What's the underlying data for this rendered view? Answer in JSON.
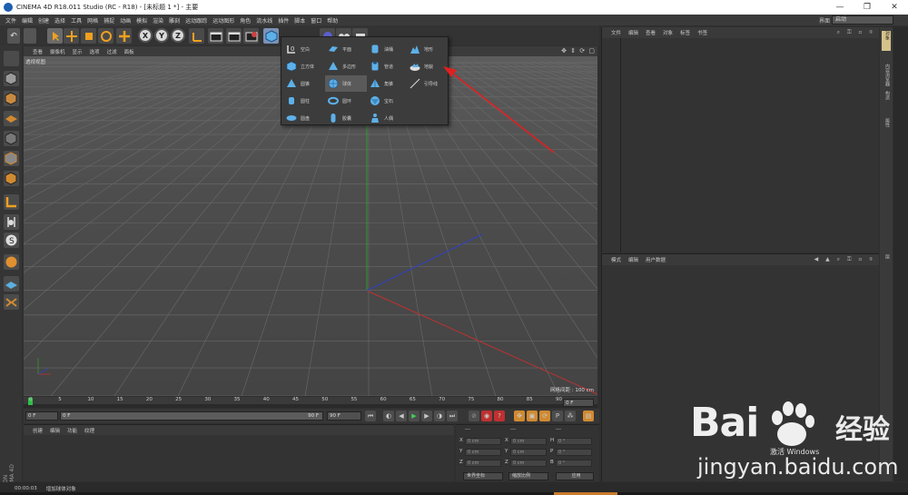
{
  "window": {
    "title": "CINEMA 4D R18.011 Studio (RC - R18) - [未标题 1 *] - 主要",
    "controls": [
      "—",
      "❐",
      "✕"
    ]
  },
  "menubar": {
    "items": [
      "文件",
      "编辑",
      "创建",
      "选择",
      "工具",
      "网格",
      "捕捉",
      "动画",
      "模拟",
      "渲染",
      "雕刻",
      "运动跟踪",
      "运动图形",
      "角色",
      "流水线",
      "插件",
      "脚本",
      "窗口",
      "帮助"
    ],
    "layout_label": "界面",
    "layout_value": "启动"
  },
  "viewport": {
    "menu": [
      "查看",
      "摄像机",
      "显示",
      "选项",
      "过滤",
      "面板"
    ],
    "label": "透视视图",
    "grid_info": "网格间距 : 100 cm",
    "nav_icons": "✥ ⇕ ⟳ ▢"
  },
  "palette": {
    "items": [
      {
        "label": "空白",
        "icon": "null-icon"
      },
      {
        "label": "立方体",
        "icon": "cube-icon"
      },
      {
        "label": "圆锥",
        "icon": "cone-icon"
      },
      {
        "label": "圆柱",
        "icon": "cylinder-icon"
      },
      {
        "label": "圆盘",
        "icon": "disc-icon"
      },
      {
        "label": "平面",
        "icon": "plane-icon"
      },
      {
        "label": "多边形",
        "icon": "polygon-icon"
      },
      {
        "label": "球体",
        "icon": "sphere-icon"
      },
      {
        "label": "圆环",
        "icon": "torus-icon"
      },
      {
        "label": "胶囊",
        "icon": "capsule-icon"
      },
      {
        "label": "油桶",
        "icon": "oil-tank-icon"
      },
      {
        "label": "管道",
        "icon": "tube-icon"
      },
      {
        "label": "角锥",
        "icon": "pyramid-icon"
      },
      {
        "label": "宝石",
        "icon": "gem-icon"
      },
      {
        "label": "人偶",
        "icon": "figure-icon"
      },
      {
        "label": "地形",
        "icon": "landscape-icon"
      },
      {
        "label": "地貌",
        "icon": "relief-icon"
      },
      {
        "label": "引导线",
        "icon": "guide-icon"
      }
    ],
    "highlighted": "球体"
  },
  "timeline": {
    "ticks": [
      "0",
      "5",
      "10",
      "15",
      "20",
      "25",
      "30",
      "35",
      "40",
      "45",
      "50",
      "55",
      "60",
      "65",
      "70",
      "75",
      "80",
      "85",
      "90"
    ],
    "current_frame_field": "0 F"
  },
  "transport": {
    "start_field": "0 F",
    "range_start": "0 F",
    "range_end": "90 F",
    "end_field": "90 F"
  },
  "material_manager": {
    "menu": [
      "创建",
      "编辑",
      "功能",
      "纹理"
    ]
  },
  "coordinates": {
    "header": [
      "---",
      "---",
      "---"
    ],
    "rows": [
      {
        "axis": "X",
        "pos": "0 cm",
        "axis2": "X",
        "size": "0 cm",
        "axis3": "H",
        "rot": "0 °"
      },
      {
        "axis": "Y",
        "pos": "0 cm",
        "axis2": "Y",
        "size": "0 cm",
        "axis3": "P",
        "rot": "0 °"
      },
      {
        "axis": "Z",
        "pos": "0 cm",
        "axis2": "Z",
        "size": "0 cm",
        "axis3": "B",
        "rot": "0 °"
      }
    ],
    "mode_select": "世界坐标",
    "scale_select": "缩放比例",
    "apply_button": "应用"
  },
  "object_manager": {
    "menu": [
      "文件",
      "编辑",
      "查看",
      "对象",
      "标签",
      "书签"
    ]
  },
  "attribute_manager": {
    "menu": [
      "模式",
      "编辑",
      "用户数据"
    ]
  },
  "sidetabs": [
    "对象",
    "内容浏览器",
    "构造",
    "属性",
    "层"
  ],
  "statusbar": {
    "time": "00:00:03",
    "message": "增加球体对象"
  },
  "branding": {
    "maxon": "MAXON CINEMA 4D"
  },
  "watermark": {
    "brand": "Bai",
    "brand_suffix": "经验",
    "url": "jingyan.baidu.com"
  },
  "activate_windows": "激活 Windows",
  "colors": {
    "annotation_arrow": "#e02020",
    "x_axis": "#c03030",
    "y_axis": "#2f9a2f",
    "z_axis": "#3040c0",
    "active_tab": "#d5c28a"
  }
}
